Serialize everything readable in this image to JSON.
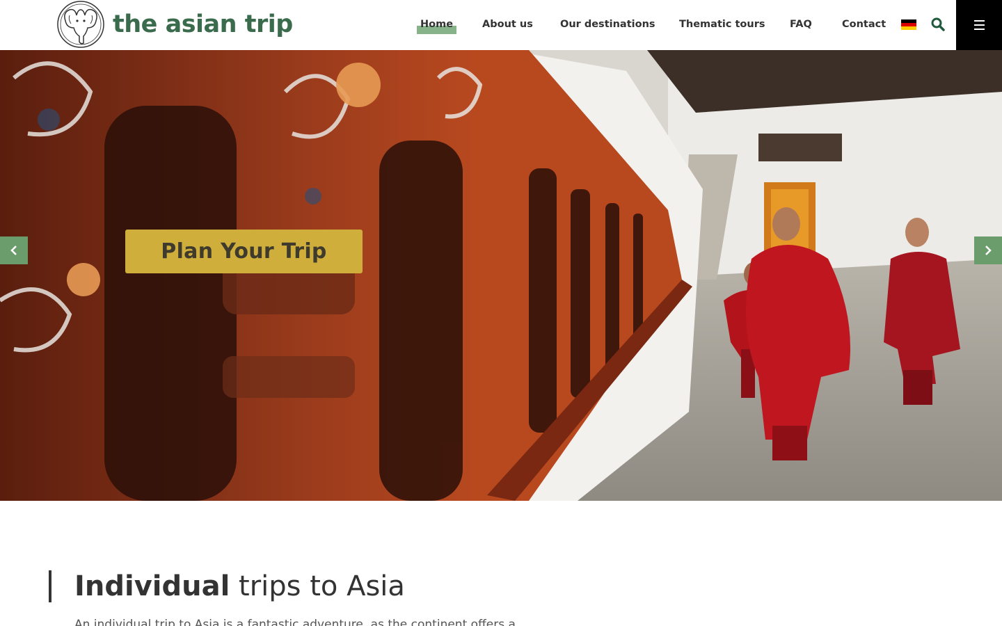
{
  "header": {
    "logo_text": "the asian trip",
    "logo_icon": "elephant-icon",
    "nav": [
      {
        "label": "Home",
        "active": true
      },
      {
        "label": "About us",
        "active": false
      },
      {
        "label": "Our destinations",
        "active": false
      },
      {
        "label": "Thematic tours",
        "active": false
      },
      {
        "label": "FAQ",
        "active": false
      },
      {
        "label": "Contact",
        "active": false
      }
    ],
    "language_icon": "german-flag-icon",
    "search_icon": "search-icon",
    "menu_icon": "hamburger-menu-icon"
  },
  "hero": {
    "cta_label": "Plan Your Trip",
    "prev_icon": "chevron-left-icon",
    "next_icon": "chevron-right-icon"
  },
  "intro": {
    "title_bold": "Individual",
    "title_rest": " trips to Asia",
    "text": "An individual trip to Asia is a fantastic adventure, as the continent offers a"
  },
  "colors": {
    "brand_green": "#3a6b4c",
    "nav_highlight": "#86b38a",
    "cta_gold": "#cfae3c",
    "arrow_green": "#6a9c6c"
  }
}
